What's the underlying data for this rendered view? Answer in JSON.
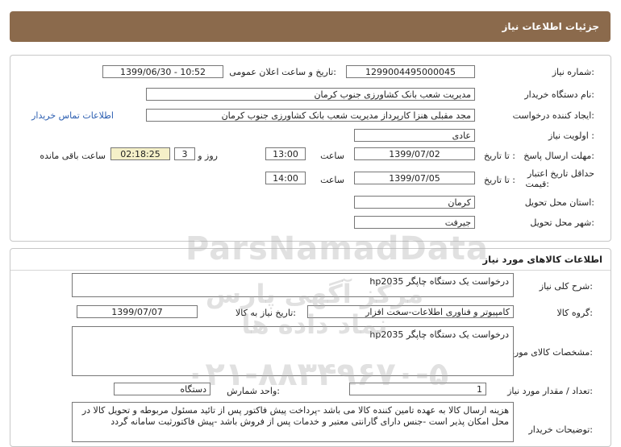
{
  "header": {
    "title": "جزئیات اطلاعات نیاز"
  },
  "need_info": {
    "need_number_label": "شماره نیاز:",
    "need_number": "1299004495000045",
    "announce_label": "تاریخ و ساعت اعلان عمومی:",
    "announce_value": "1399/06/30 - 10:52",
    "buyer_org_label": "نام دستگاه خریدار:",
    "buyer_org": "مدیریت شعب بانک کشاورزی جنوب کرمان",
    "creator_label": "ایجاد کننده درخواست:",
    "creator": "مجد مقبلی هنزا کارپرداز مدیریت شعب بانک کشاورزی جنوب کرمان",
    "contact_link": "اطلاعات تماس خریدار",
    "priority_label": "اولویت نیاز :",
    "priority": "عادی",
    "deadline_label": "مهلت ارسال پاسخ:",
    "to_date_label": "تا تاریخ :",
    "deadline_date": "1399/07/02",
    "time_label": "ساعت",
    "deadline_time": "13:00",
    "days": "3",
    "day_and_label": "روز و",
    "remaining": "02:18:25",
    "remaining_label": "ساعت باقی مانده",
    "validity_label_1": "حداقل تاریخ اعتبار",
    "validity_label_2": "قیمت:",
    "validity_date": "1399/07/05",
    "validity_time": "14:00",
    "province_label": "استان محل تحویل:",
    "province": "کرمان",
    "city_label": "شهر محل تحویل:",
    "city": "جیرفت"
  },
  "goods": {
    "title": "اطلاعات کالاهای مورد نیاز",
    "desc_label": "شرح کلی نیاز:",
    "desc": "درخواست یک دستگاه چاپگر hp2035",
    "group_label": "گروه کالا:",
    "group": "کامپیوتر و فناوری اطلاعات-سخت افزار",
    "need_date_label": "تاریخ نیاز به کالا:",
    "need_date": "1399/07/07",
    "spec_label": "مشخصات کالای مورد نیاز:",
    "spec": "درخواست یک دستگاه چاپگر hp2035",
    "qty_label": "تعداد / مقدار مورد نیاز:",
    "qty": "1",
    "unit_label": "واحد شمارش:",
    "unit": "دستگاه",
    "buyer_notes_label": "توضیحات خریدار:",
    "buyer_notes": "هزینه ارسال کالا به عهده تامین کننده کالا می باشد -پرداخت پیش فاکتور پس از تائید مسئول مربوطه و تحویل کالا در محل امکان  پذیر است -جنس دارای گارانتی معتبر و خدمات پس از فروش باشد -پیش فاکتورثبت سامانه گردد"
  },
  "watermark": {
    "line1": "ParsNamadData",
    "line2": "مرکز آگهی پارس نماد داده ها",
    "line3": "۰۲۱-۸۸۳۴۹۶۷۰-۵"
  }
}
